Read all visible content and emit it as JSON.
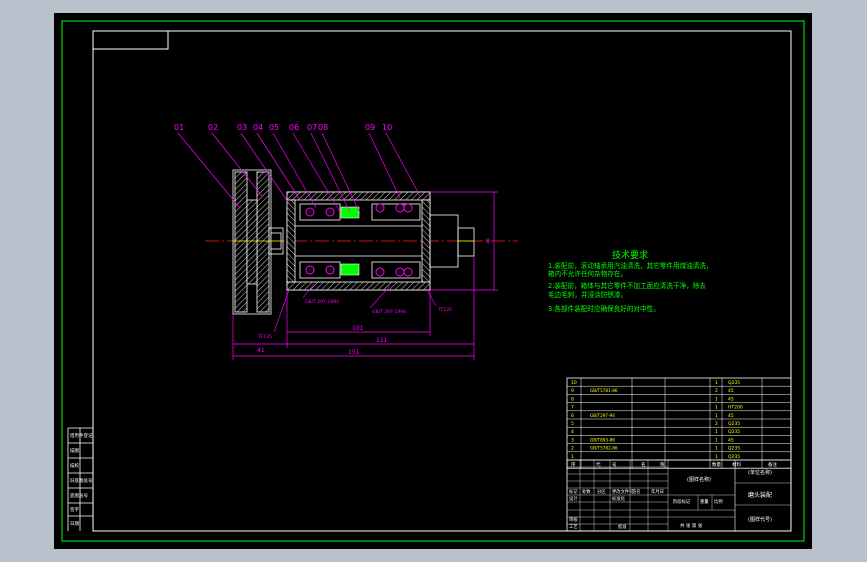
{
  "balloons": [
    "01",
    "02",
    "03",
    "04",
    "05",
    "06",
    "07",
    "08",
    "09",
    "10"
  ],
  "tech": {
    "title": "技术要求",
    "lines": [
      "1.装配前，滚动轴承用汽油清洗，其它零件用煤油清洗，",
      "箱内不允许任何杂物存在。",
      "2.装配前，箱体与其它零件不加工面应清洗干净，除去",
      "毛边毛刺，并浸涂防锈漆。",
      "3.各部件装配时应确保良好的对中性。"
    ]
  },
  "dims": {
    "len_total": "151",
    "len_mid": "111",
    "len_inner": "101",
    "len_left": "41",
    "height": "8"
  },
  "callouts": [
    "GB/T 297-1994",
    "GB/T 297-1994",
    "TF135",
    "TF135"
  ],
  "bom": [
    {
      "no": "10",
      "code": "",
      "name": "",
      "qty": "1",
      "mat": "Q235"
    },
    {
      "no": "9",
      "code": "GB/T5781-86",
      "name": "",
      "qty": "2",
      "mat": "45"
    },
    {
      "no": "8",
      "code": "",
      "name": "",
      "qty": "1",
      "mat": "45"
    },
    {
      "no": "7",
      "code": "",
      "name": "",
      "qty": "1",
      "mat": "HT200"
    },
    {
      "no": "6",
      "code": "GB/T297-94",
      "name": "",
      "qty": "1",
      "mat": "45"
    },
    {
      "no": "5",
      "code": "",
      "name": "",
      "qty": "2",
      "mat": "Q235"
    },
    {
      "no": "4",
      "code": "",
      "name": "",
      "qty": "1",
      "mat": "Q235"
    },
    {
      "no": "3",
      "code": "GB/T893-86",
      "name": "",
      "qty": "1",
      "mat": "45"
    },
    {
      "no": "2",
      "code": "GB/T5782-86",
      "name": "",
      "qty": "1",
      "mat": "Q235"
    },
    {
      "no": "1",
      "code": "",
      "name": "",
      "qty": "1",
      "mat": "Q235"
    }
  ],
  "bom_header": [
    "序",
    "代",
    "号",
    "名",
    "称",
    "数量",
    "材料",
    "备注"
  ],
  "title_block": {
    "drawing_name": "(图样名称)",
    "unit": "(单位名称)",
    "code": "(图样代号)",
    "part": "磨头装配",
    "marks": "标记",
    "count": "处数",
    "zone": "分区",
    "change_doc": "更改文件号",
    "sign": "签名",
    "date": "年月日",
    "designer": "设计",
    "standard": "标准化",
    "review": "审核",
    "process": "工艺",
    "approve": "批准",
    "stage": "阶段标记",
    "weight": "重量",
    "scale": "比例",
    "sheets": "共 张 第 张"
  },
  "side_labels": [
    "借用件登记",
    "描图",
    "描校",
    "旧底图总号",
    "底图总号",
    "签字",
    "日期"
  ],
  "colors": {
    "frame": "#ffffff",
    "green": "#00ff00",
    "yellow": "#ffff00",
    "magenta": "#ff00ff",
    "red": "#ff2020",
    "cyan": "#00ffff"
  }
}
